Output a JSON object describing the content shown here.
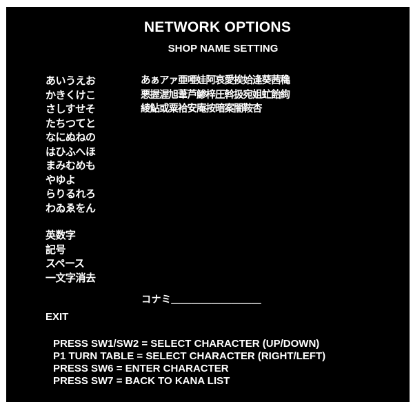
{
  "screen": {
    "title": "NETWORK OPTIONS",
    "subtitle": "SHOP NAME SETTING"
  },
  "kana_list": [
    "あいうえお",
    "かきくけこ",
    "さしすせそ",
    "たちつてと",
    "なにぬねの",
    "はひふへほ",
    "まみむめも",
    "やゆよ",
    "らりるれろ",
    "わゐゑをん"
  ],
  "special_options": [
    "英数字",
    "記号",
    "スペース",
    "一文字消去"
  ],
  "kanji_grid": [
    "あぁアァ亜唖娃阿哀愛挨姶逢葵茜穐",
    "悪握渥旭葦芦鯵梓圧斡扱宛姐虻飴絢",
    "綾鮎或粟袷安庵按暗案闇鞍杏"
  ],
  "name_entry": {
    "value": "コナミ＿＿＿＿＿＿＿＿＿"
  },
  "exit_label": "EXIT",
  "instructions": [
    "PRESS SW1/SW2 = SELECT CHARACTER (UP/DOWN)",
    "P1 TURN TABLE = SELECT CHARACTER (RIGHT/LEFT)",
    "PRESS SW6 = ENTER CHARACTER",
    "PRESS SW7 = BACK TO KANA LIST"
  ],
  "colors": {
    "background": "#000000",
    "text": "#ffffff",
    "frame": "#ffffff"
  }
}
